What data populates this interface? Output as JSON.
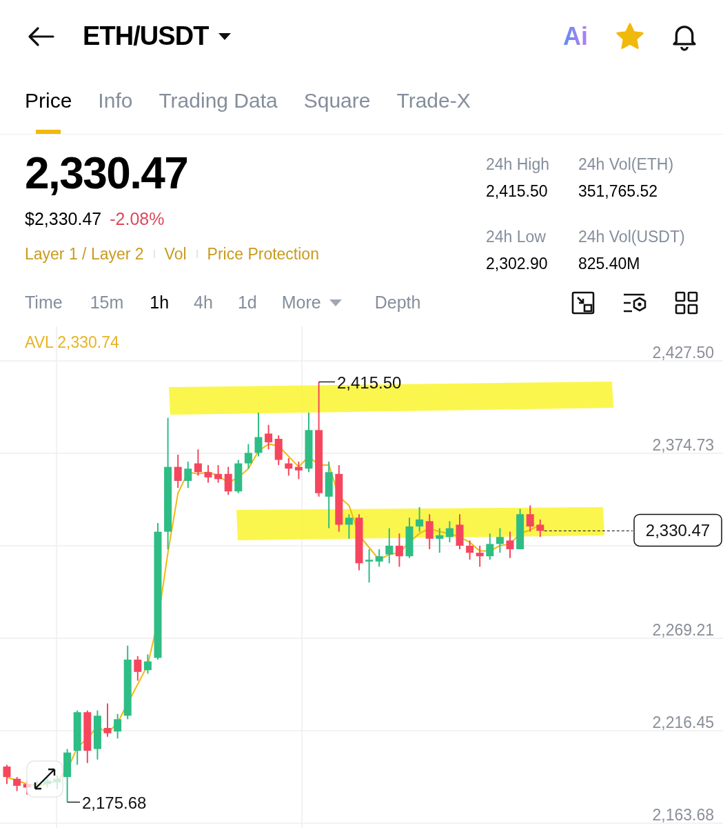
{
  "header": {
    "pair": "ETH/USDT",
    "ai_label": "Ai",
    "favorite": true
  },
  "tabs": [
    {
      "label": "Price",
      "selected": true
    },
    {
      "label": "Info",
      "selected": false
    },
    {
      "label": "Trading Data",
      "selected": false
    },
    {
      "label": "Square",
      "selected": false
    },
    {
      "label": "Trade-X",
      "selected": false
    }
  ],
  "price": {
    "last": "2,330.47",
    "usd": "$2,330.47",
    "change": "-2.08%"
  },
  "tags": [
    "Layer 1 / Layer 2",
    "Vol",
    "Price Protection"
  ],
  "stats": [
    {
      "label": "24h High",
      "value": "2,415.50"
    },
    {
      "label": "24h Vol(ETH)",
      "value": "351,765.52"
    },
    {
      "label": "24h Low",
      "value": "2,302.90"
    },
    {
      "label": "24h Vol(USDT)",
      "value": "825.40M"
    }
  ],
  "intervals": [
    {
      "label": "Time",
      "selected": false,
      "kind": "plain"
    },
    {
      "label": "15m",
      "selected": false,
      "kind": "plain"
    },
    {
      "label": "1h",
      "selected": true,
      "kind": "plain"
    },
    {
      "label": "4h",
      "selected": false,
      "kind": "plain"
    },
    {
      "label": "1d",
      "selected": false,
      "kind": "plain"
    },
    {
      "label": "More",
      "selected": false,
      "kind": "dropdown"
    },
    {
      "label": "Depth",
      "selected": false,
      "kind": "plain"
    }
  ],
  "chart": {
    "avl_label": "AVL 2,330.74",
    "max_label": "2,415.50",
    "min_label": "2,175.68",
    "current_label": "2,330.47",
    "y_axis_labels": [
      "2,427.50",
      "2,374.73",
      "2,269.21",
      "2,216.45",
      "2,163.68"
    ]
  }
}
